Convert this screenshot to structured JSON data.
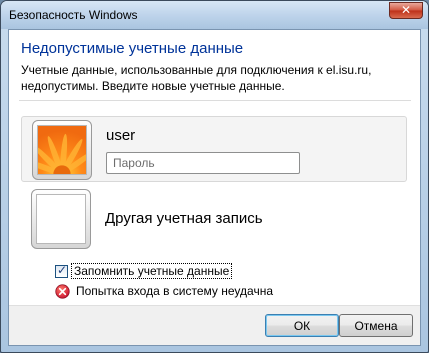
{
  "window": {
    "title": "Безопасность Windows",
    "close_glyph": "✕"
  },
  "dialog": {
    "heading": "Недопустимые учетные данные",
    "description": "Учетные данные, использованные для подключения к el.isu.ru, недопустимы. Введите новые учетные данные."
  },
  "credential_tile": {
    "user_name": "user",
    "password": {
      "placeholder": "Пароль",
      "value": ""
    },
    "avatar": "flower-avatar-icon"
  },
  "other_tile": {
    "label": "Другая учетная запись",
    "avatar": "blank-avatar-icon"
  },
  "remember": {
    "label": "Запомнить учетные данные",
    "checked": true,
    "mark": "✓"
  },
  "error": {
    "text": "Попытка входа в систему неудачна",
    "icon": "error-x-icon",
    "color": "#c8102e"
  },
  "buttons": {
    "ok": "ОК",
    "cancel": "Отмена"
  },
  "colors": {
    "heading": "#003399",
    "title_bar": "#bcd2ea",
    "close_button": "#c8402a"
  }
}
